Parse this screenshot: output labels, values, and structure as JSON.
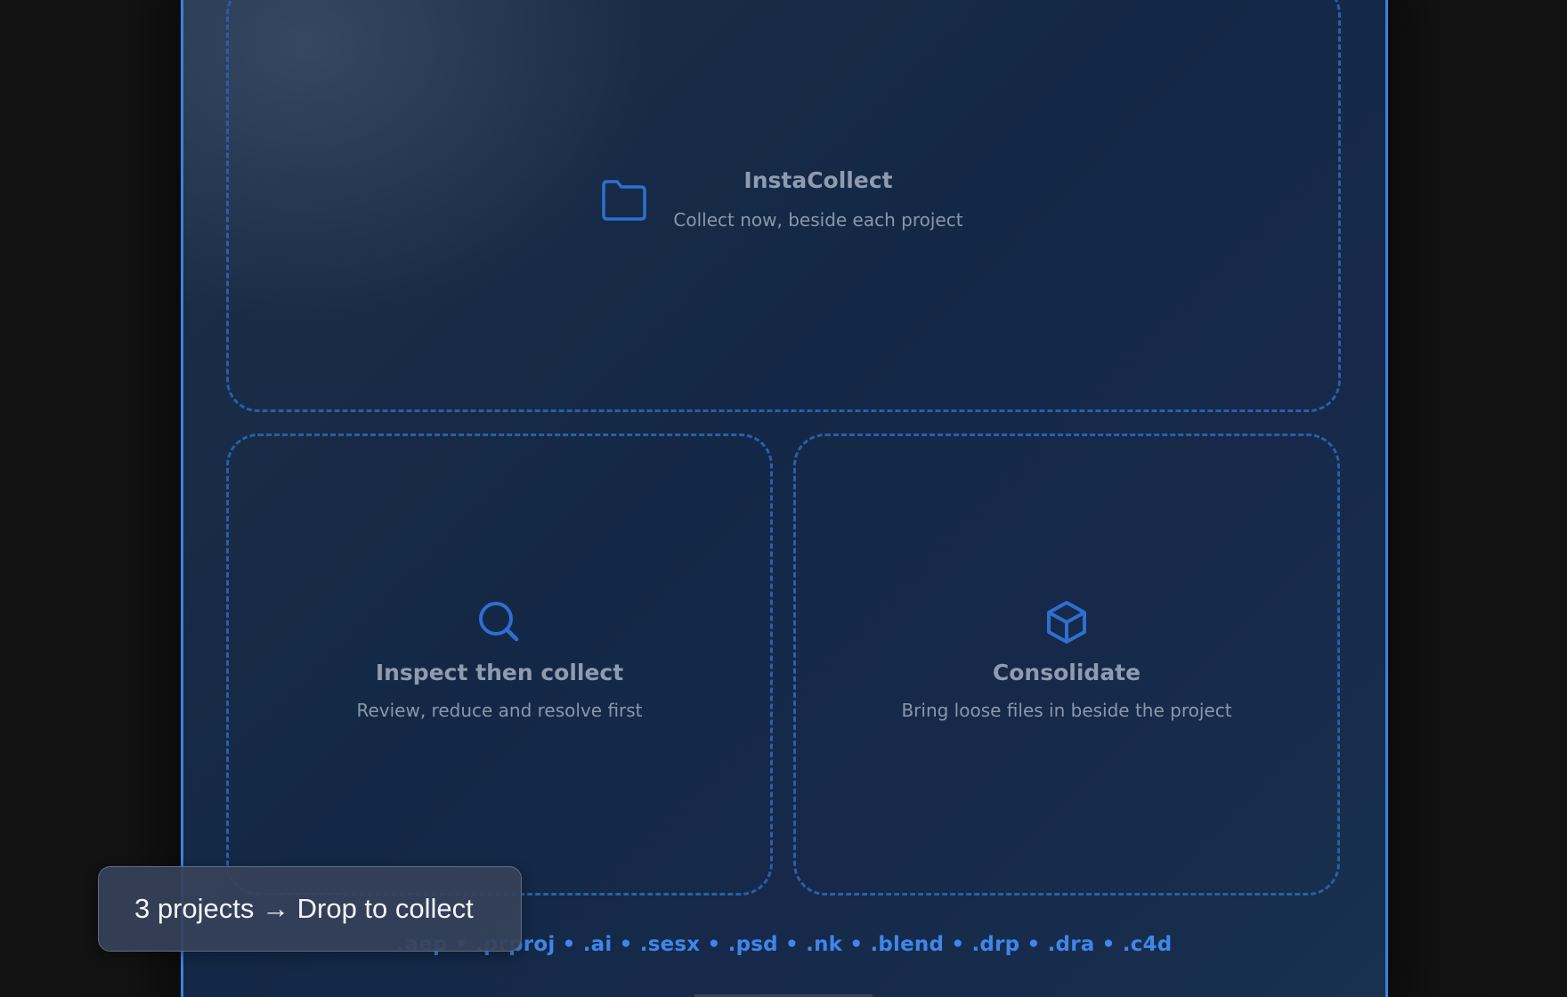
{
  "colors": {
    "background": "#131313",
    "accent": "#3b82e0",
    "dashed_border": "#2a5ea8",
    "title_text": "#8f9bb0",
    "subtitle_text": "#8a97ab",
    "toast_background": "#364259",
    "toast_text": "#f2f5fa"
  },
  "drop_zones": {
    "insta_collect": {
      "icon": "folder-icon",
      "title": "InstaCollect",
      "subtitle": "Collect now, beside each project"
    },
    "inspect": {
      "icon": "search-icon",
      "title": "Inspect then collect",
      "subtitle": "Review, reduce and resolve first"
    },
    "consolidate": {
      "icon": "cube-icon",
      "title": "Consolidate",
      "subtitle": "Bring loose files in beside the project"
    }
  },
  "supported_extensions": ".aep • .prproj • .ai • .sesx • .psd • .nk • .blend • .drp • .dra • .c4d",
  "toast": {
    "text": "3 projects → Drop to collect"
  }
}
